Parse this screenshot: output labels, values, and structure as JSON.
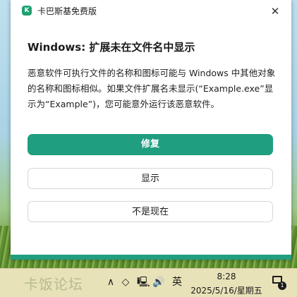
{
  "dialog": {
    "app_icon_letter": "K",
    "app_title": "卡巴斯基免费版",
    "close_glyph": "✕",
    "heading": "Windows: 扩展未在文件名中显示",
    "description": "恶意软件可执行文件的名称和图标可能与 Windows 中其他对象的名称和图标相似。如果文件扩展名未显示(“Example.exe”显示为“Example”)，您可能意外运行该恶意软件。",
    "buttons": {
      "fix": "修复",
      "show": "显示",
      "not_now": "不是现在"
    }
  },
  "taskbar": {
    "watermark": "卡饭论坛",
    "chevron": "∧",
    "diamond": "◇",
    "network": "🖳",
    "volume": "🔊",
    "ime": "英",
    "time": "8:28",
    "date": "2025/5/16/星期五",
    "notification_count": "1"
  },
  "colors": {
    "accent": "#1f9e80",
    "brand_icon": "#1ea070"
  }
}
